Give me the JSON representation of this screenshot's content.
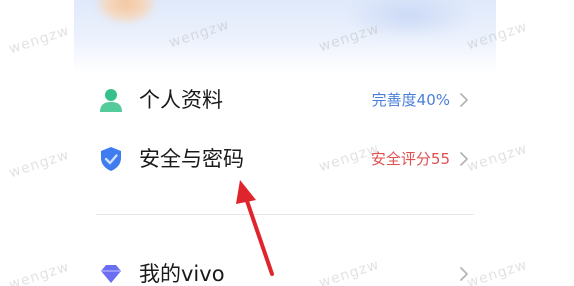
{
  "menu": {
    "items": [
      {
        "label": "个人资料",
        "value": "完善度40%",
        "value_color": "#4a7fd9",
        "icon": "person-icon",
        "icon_color": "#35c28a"
      },
      {
        "label": "安全与密码",
        "value": "安全评分55",
        "value_color": "#e05050",
        "icon": "shield-icon",
        "icon_color": "#3f7cf0"
      },
      {
        "label": "我的vivo",
        "value": "",
        "value_color": "#999999",
        "icon": "diamond-icon",
        "icon_color": "#6b6df2"
      }
    ]
  },
  "watermark_text": "wengzw",
  "annotation": {
    "arrow_color": "#e0242b"
  }
}
